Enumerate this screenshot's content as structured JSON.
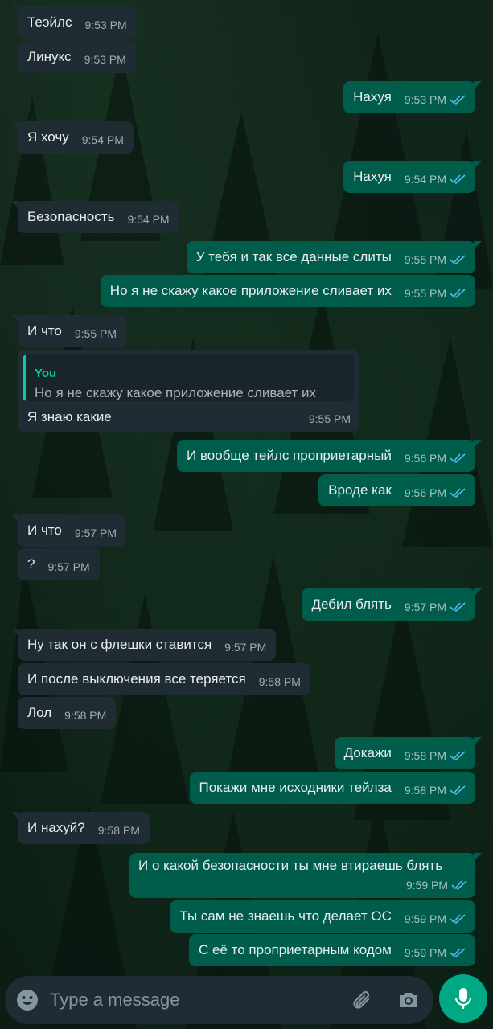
{
  "chat": {
    "messages": [
      {
        "text": "Теэйлс",
        "time": "9:53 PM"
      },
      {
        "text": "Линукс",
        "time": "9:53 PM"
      },
      {
        "text": "Нахуя",
        "time": "9:53 PM"
      },
      {
        "text": "Я хочу",
        "time": "9:54 PM"
      },
      {
        "text": "Нахуя",
        "time": "9:54 PM"
      },
      {
        "text": "Безопасность",
        "time": "9:54 PM"
      },
      {
        "text": "У тебя и так все данные слиты",
        "time": "9:55 PM"
      },
      {
        "text": "Но я не скажу какое приложение сливает их",
        "time": "9:55 PM"
      },
      {
        "text": "И что",
        "time": "9:55 PM"
      },
      {
        "text": "Я знаю какие",
        "time": "9:55 PM"
      },
      {
        "text": "И вообще тейлс проприетарный",
        "time": "9:56 PM"
      },
      {
        "text": "Вроде как",
        "time": "9:56 PM"
      },
      {
        "text": "И что",
        "time": "9:57 PM"
      },
      {
        "text": "?",
        "time": "9:57 PM"
      },
      {
        "text": "Дебил блять",
        "time": "9:57 PM"
      },
      {
        "text": "Ну так он с флешки ставится",
        "time": "9:57 PM"
      },
      {
        "text": "И после выключения все теряется",
        "time": "9:58 PM"
      },
      {
        "text": "Лол",
        "time": "9:58 PM"
      },
      {
        "text": "Докажи",
        "time": "9:58 PM"
      },
      {
        "text": "Покажи мне исходники тейлза",
        "time": "9:58 PM"
      },
      {
        "text": "И нахуй?",
        "time": "9:58 PM"
      },
      {
        "text": "И о какой безопасности ты мне втираешь блять",
        "time": "9:59 PM"
      },
      {
        "text": "Ты сам не знаешь что делает ОС",
        "time": "9:59 PM"
      },
      {
        "text": "С её то проприетарным кодом",
        "time": "9:59 PM"
      }
    ],
    "quote": {
      "author": "You",
      "text": "Но я не скажу какое приложение сливает их"
    }
  },
  "composer": {
    "placeholder": "Type a message"
  },
  "colors": {
    "incoming": "#1f2c33",
    "outgoing": "#005c4b",
    "accent": "#00a884",
    "read_tick": "#53bdeb"
  },
  "icons": [
    "emoji-icon",
    "attach-icon",
    "camera-icon",
    "mic-icon",
    "double-check-icon"
  ]
}
